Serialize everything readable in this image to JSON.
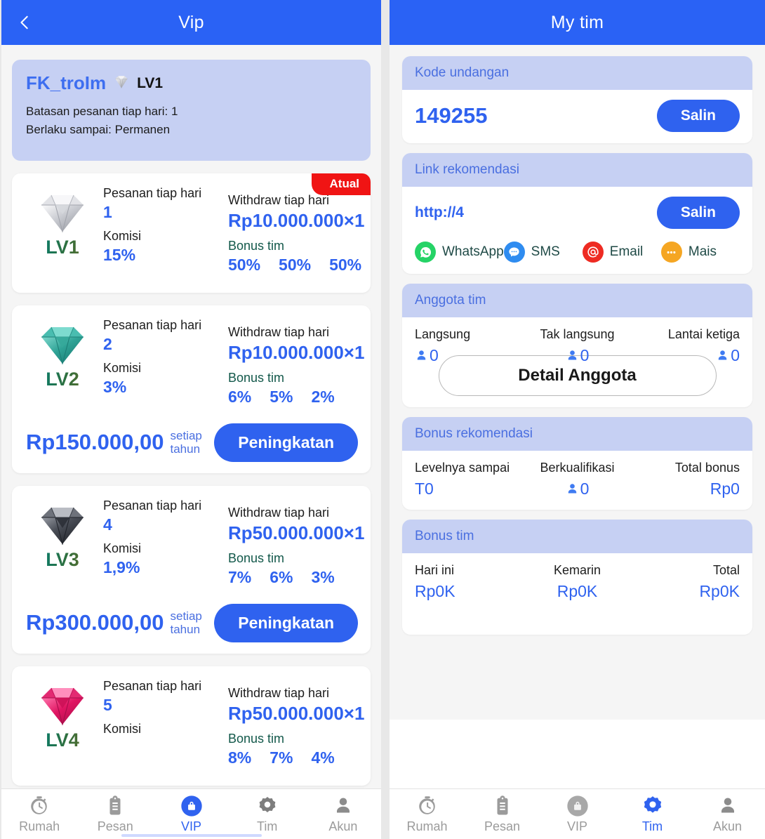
{
  "colors": {
    "primary": "#2a62f5",
    "accent": "#2f62ef",
    "header_band": "#c6d0f3",
    "ribbon_red": "#f01414",
    "page_bg": "#f5f5f5"
  },
  "left_panel": {
    "appbar": {
      "title": "Vip",
      "back_icon": "chevron-left-icon"
    },
    "user_info": {
      "username": "FK_troIm",
      "level_badge_icon": "diamond-icon",
      "level": "LV1",
      "line1": "Batasan pesanan tiap hari: 1",
      "line2": "Berlaku sampai: Permanen"
    },
    "labels": {
      "orders": "Pesanan tiap hari",
      "commission": "Komisi",
      "withdraw": "Withdraw tiap hari",
      "team_bonus": "Bonus tim",
      "per_year": "setiap tahun",
      "upgrade": "Peningkatan",
      "current_badge": "Atual"
    },
    "vip_cards": [
      {
        "level": "LV1",
        "diamond_color": "silver",
        "orders_per_day": "1",
        "commission": "15%",
        "withdraw": "Rp10.000.000×1",
        "team_bonus": [
          "50%",
          "50%",
          "50%"
        ],
        "price": "",
        "is_current": true,
        "has_upgrade": false
      },
      {
        "level": "LV2",
        "diamond_color": "teal",
        "orders_per_day": "2",
        "commission": "3%",
        "withdraw": "Rp10.000.000×1",
        "team_bonus": [
          "6%",
          "5%",
          "2%"
        ],
        "price": "Rp150.000,00",
        "is_current": false,
        "has_upgrade": true
      },
      {
        "level": "LV3",
        "diamond_color": "black",
        "orders_per_day": "4",
        "commission": "1,9%",
        "withdraw": "Rp50.000.000×1",
        "team_bonus": [
          "7%",
          "6%",
          "3%"
        ],
        "price": "Rp300.000,00",
        "is_current": false,
        "has_upgrade": true
      },
      {
        "level": "LV4",
        "diamond_color": "pink",
        "orders_per_day": "5",
        "commission": "",
        "withdraw": "Rp50.000.000×1",
        "team_bonus": [
          "8%",
          "7%",
          "4%"
        ],
        "price": "",
        "is_current": false,
        "has_upgrade": false
      }
    ],
    "tabbar": [
      {
        "label": "Rumah",
        "icon": "stopwatch-icon",
        "active": false
      },
      {
        "label": "Pesan",
        "icon": "clipboard-icon",
        "active": false
      },
      {
        "label": "VIP",
        "icon": "lock-bag-icon",
        "active": true
      },
      {
        "label": "Tim",
        "icon": "gear-icon",
        "active": false
      },
      {
        "label": "Akun",
        "icon": "person-icon",
        "active": false
      }
    ]
  },
  "right_panel": {
    "appbar": {
      "title": "My tim"
    },
    "invite_code": {
      "header": "Kode undangan",
      "code": "149255",
      "copy_label": "Salin"
    },
    "recommend_link": {
      "header": "Link rekomendasi",
      "url": "http://4",
      "copy_label": "Salin",
      "share": [
        {
          "label": "WhatsApp",
          "icon": "whatsapp-icon",
          "color": "#25d366"
        },
        {
          "label": "SMS",
          "icon": "sms-icon",
          "color": "#2f8cf0"
        },
        {
          "label": "Email",
          "icon": "email-at-icon",
          "color": "#ee2b22"
        },
        {
          "label": "Mais",
          "icon": "more-dots-icon",
          "color": "#f5a623"
        }
      ]
    },
    "team_members": {
      "header": "Anggota tim",
      "stats": [
        {
          "label": "Langsung",
          "value": "0",
          "icon": "person-icon"
        },
        {
          "label": "Tak langsung",
          "value": "0",
          "icon": "person-icon"
        },
        {
          "label": "Lantai ketiga",
          "value": "0",
          "icon": "person-icon"
        }
      ],
      "detail_button": "Detail Anggota"
    },
    "recommend_bonus": {
      "header": "Bonus rekomendasi",
      "stats": [
        {
          "label": "Levelnya sampai",
          "value": "T0",
          "icon": ""
        },
        {
          "label": "Berkualifikasi",
          "value": "0",
          "icon": "person-icon"
        },
        {
          "label": "Total bonus",
          "value": "Rp0",
          "icon": ""
        }
      ]
    },
    "team_bonus": {
      "header": "Bonus tim",
      "stats": [
        {
          "label": "Hari ini",
          "value": "Rp0K",
          "icon": ""
        },
        {
          "label": "Kemarin",
          "value": "Rp0K",
          "icon": ""
        },
        {
          "label": "Total",
          "value": "Rp0K",
          "icon": ""
        }
      ]
    },
    "tabbar": [
      {
        "label": "Rumah",
        "icon": "stopwatch-icon",
        "active": false
      },
      {
        "label": "Pesan",
        "icon": "clipboard-icon",
        "active": false
      },
      {
        "label": "VIP",
        "icon": "lock-bag-icon",
        "active": false
      },
      {
        "label": "Tim",
        "icon": "gear-icon",
        "active": true
      },
      {
        "label": "Akun",
        "icon": "person-icon",
        "active": false
      }
    ]
  }
}
